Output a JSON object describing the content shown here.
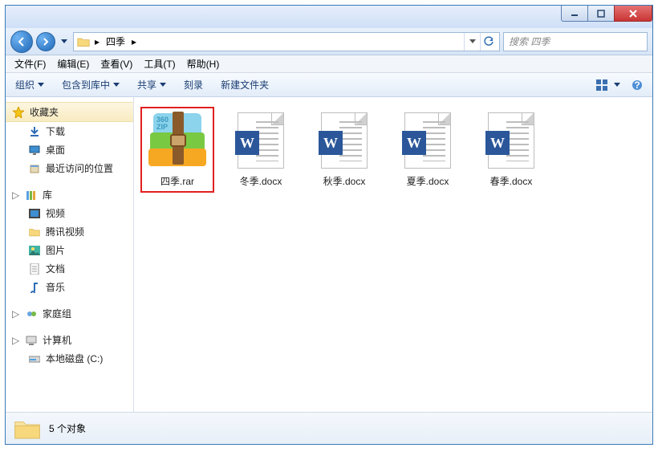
{
  "titlebar": {},
  "nav": {
    "path_segment": "四季",
    "search_placeholder": "搜索 四季"
  },
  "menu": {
    "file": "文件(F)",
    "edit": "编辑(E)",
    "view": "查看(V)",
    "tools": "工具(T)",
    "help": "帮助(H)"
  },
  "toolbar": {
    "organize": "组织",
    "include": "包含到库中",
    "share": "共享",
    "burn": "刻录",
    "new_folder": "新建文件夹"
  },
  "sidebar": {
    "favorites": {
      "header": "收藏夹",
      "items": [
        "下载",
        "桌面",
        "最近访问的位置"
      ]
    },
    "libraries": {
      "header": "库",
      "items": [
        "视频",
        "腾讯视频",
        "图片",
        "文档",
        "音乐"
      ]
    },
    "homegroup": {
      "header": "家庭组"
    },
    "computer": {
      "header": "计算机",
      "items": [
        "本地磁盘 (C:)"
      ]
    }
  },
  "files": [
    {
      "name": "四季.rar",
      "type": "rar",
      "selected": true
    },
    {
      "name": "冬季.docx",
      "type": "docx",
      "selected": false
    },
    {
      "name": "秋季.docx",
      "type": "docx",
      "selected": false
    },
    {
      "name": "夏季.docx",
      "type": "docx",
      "selected": false
    },
    {
      "name": "春季.docx",
      "type": "docx",
      "selected": false
    }
  ],
  "status": {
    "count_text": "5 个对象"
  },
  "rar_badge_text": "360\nZIP"
}
